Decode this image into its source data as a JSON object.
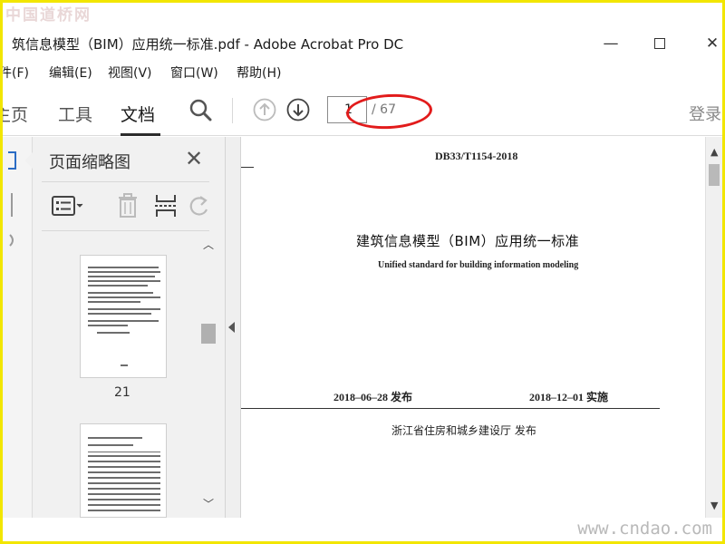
{
  "watermark": {
    "top": "中国道桥网",
    "bottom": "www.cndao.com"
  },
  "window": {
    "title": "筑信息模型（BIM）应用统一标准.pdf - Adobe Acrobat Pro DC",
    "minimize": "—",
    "close": "✕"
  },
  "menu": {
    "items": [
      "件(F)",
      "编辑(E)",
      "视图(V)",
      "窗口(W)",
      "帮助(H)"
    ]
  },
  "toolbar": {
    "tabs": [
      "主页",
      "工具",
      "文档"
    ],
    "active_tab": "文档",
    "page_current": "1",
    "page_total": "/ 67",
    "login": "登录"
  },
  "thumbnail_pane": {
    "title": "页面缩略图",
    "close": "✕",
    "thumbnails": [
      {
        "label": "21"
      },
      {
        "label": ""
      }
    ]
  },
  "document": {
    "standard_no": "DB33/T1154-2018",
    "title_cn": "建筑信息模型（BIM）应用统一标准",
    "title_en": "Unified standard for building information modeling",
    "publish_date": "2018–06–28  发布",
    "effective_date": "2018–12–01  实施",
    "issuer": "浙江省住房和城乡建设厅      发布"
  },
  "colors": {
    "annotation_ellipse": "#e21b1b",
    "frame": "#f2e600",
    "accent": "#2b6cc4"
  }
}
